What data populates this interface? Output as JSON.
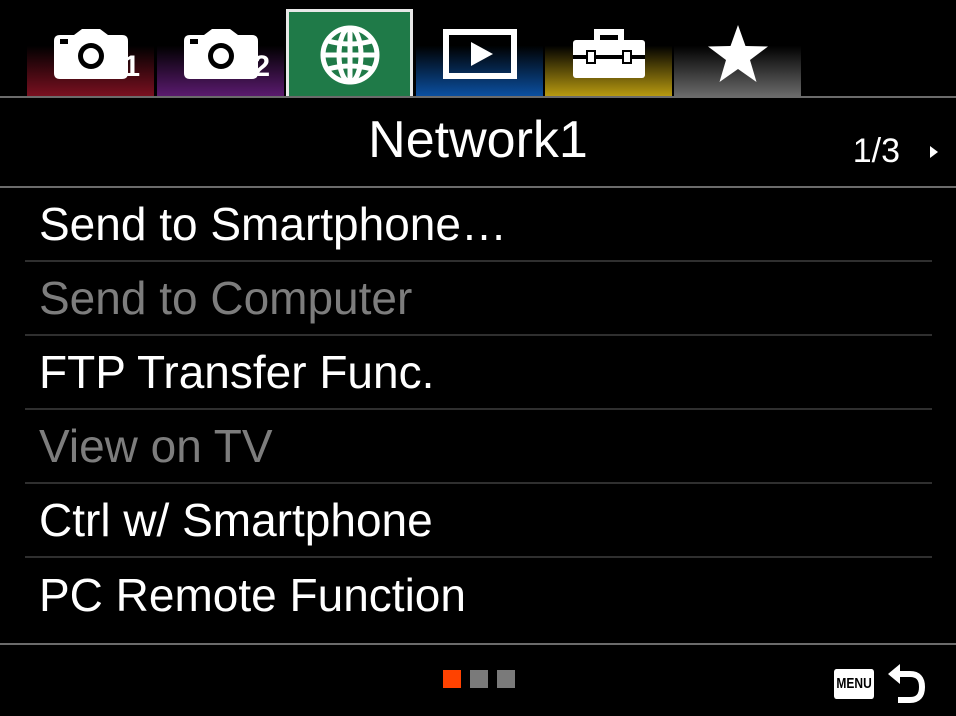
{
  "tabs": [
    {
      "icon": "camera-icon",
      "number": "1",
      "color": "#7a1020"
    },
    {
      "icon": "camera-icon",
      "number": "2",
      "color": "#5a1a6e"
    },
    {
      "icon": "globe-icon",
      "number": "",
      "color": "#1f7a48",
      "active": true
    },
    {
      "icon": "playback-icon",
      "number": "",
      "color": "#0b4fa0"
    },
    {
      "icon": "toolbox-icon",
      "number": "",
      "color": "#b89a10"
    },
    {
      "icon": "star-icon",
      "number": "",
      "color": "#6a6a6a"
    }
  ],
  "header": {
    "title": "Network1",
    "page_indicator": "1/3"
  },
  "menu": {
    "items": [
      {
        "label": "Send to Smartphone…",
        "enabled": true
      },
      {
        "label": "Send to Computer",
        "enabled": false
      },
      {
        "label": "FTP Transfer Func.",
        "enabled": true
      },
      {
        "label": "View on TV",
        "enabled": false
      },
      {
        "label": "Ctrl w/ Smartphone",
        "enabled": true
      },
      {
        "label": "PC Remote Function",
        "enabled": true
      }
    ]
  },
  "footer": {
    "page_count": 3,
    "current_page": 1,
    "menu_label": "MENU",
    "back_icon": "return-arrow-icon"
  },
  "colors": {
    "accent": "#ff4200",
    "enabled_text": "#ffffff",
    "disabled_text": "#7d7d7d"
  }
}
